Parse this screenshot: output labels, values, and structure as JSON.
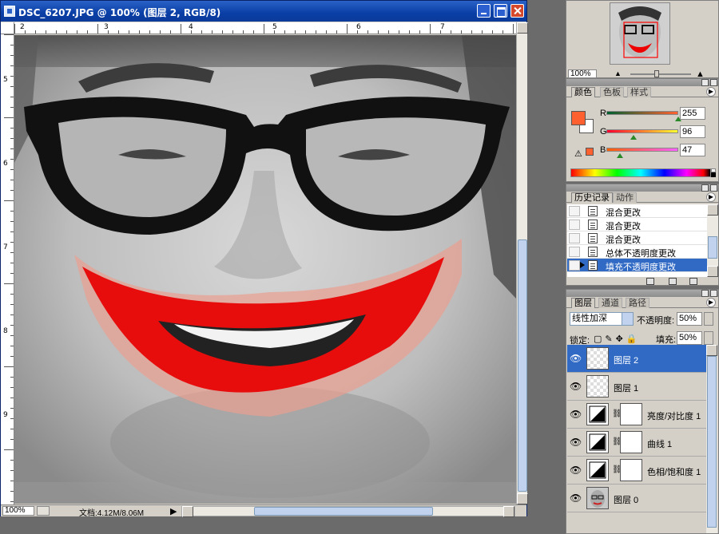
{
  "document": {
    "title": "DSC_6207.JPG @ 100% (图层 2, RGB/8)",
    "ruler_top_labels": [
      "2",
      "3",
      "4",
      "5",
      "6",
      "7"
    ],
    "ruler_left_labels": [
      "5",
      "6",
      "7",
      "8",
      "9"
    ],
    "zoom": "100%",
    "doc_info": "文档:4.12M/8.06M"
  },
  "navigator": {
    "zoom": "100%"
  },
  "color_panel": {
    "tabs": [
      "颜色",
      "色板",
      "样式"
    ],
    "fg_color": "#ff602f",
    "channels": [
      {
        "label": "R",
        "value": "255",
        "gradient": "linear-gradient(to right,#005f2f,#ff602f)",
        "knob": 1.0
      },
      {
        "label": "G",
        "value": "96",
        "gradient": "linear-gradient(to right,#ff002f,#ffff2f)",
        "knob": 0.376
      },
      {
        "label": "B",
        "value": "47",
        "gradient": "linear-gradient(to right,#ff6000,#ff60ff)",
        "knob": 0.184
      }
    ],
    "warning_icon": "gamut-warning-icon"
  },
  "history_panel": {
    "tabs": [
      "历史记录",
      "动作"
    ],
    "items": [
      {
        "label": "混合更改",
        "selected": false
      },
      {
        "label": "混合更改",
        "selected": false
      },
      {
        "label": "混合更改",
        "selected": false
      },
      {
        "label": "总体不透明度更改",
        "selected": false
      },
      {
        "label": "填充不透明度更改",
        "selected": true
      }
    ]
  },
  "layers_panel": {
    "tabs": [
      "图层",
      "通道",
      "路径"
    ],
    "blend_mode": "线性加深",
    "opacity_label": "不透明度:",
    "opacity_value": "50%",
    "lock_label": "锁定:",
    "fill_label": "填充:",
    "fill_value": "50%",
    "layers": [
      {
        "name": "图层 2",
        "selected": true,
        "type": "pixel"
      },
      {
        "name": "图层 1",
        "selected": false,
        "type": "pixel"
      },
      {
        "name": "亮度/对比度 1",
        "selected": false,
        "type": "adjustment"
      },
      {
        "name": "曲线 1",
        "selected": false,
        "type": "adjustment"
      },
      {
        "name": "色相/饱和度 1",
        "selected": false,
        "type": "adjustment"
      },
      {
        "name": "图层 0",
        "selected": false,
        "type": "photo"
      }
    ]
  }
}
